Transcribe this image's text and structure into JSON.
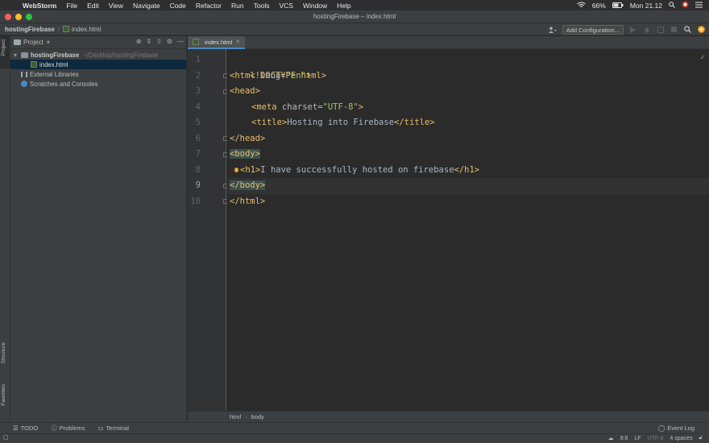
{
  "menubar": {
    "app_name": "WebStorm",
    "items": [
      "File",
      "Edit",
      "View",
      "Navigate",
      "Code",
      "Refactor",
      "Run",
      "Tools",
      "VCS",
      "Window",
      "Help"
    ],
    "battery": "66%",
    "clock": "Mon 21.12"
  },
  "window": {
    "title": "hostingFirebase – index.html",
    "traffic_colors": [
      "#fe5f57",
      "#febc2e",
      "#28c840"
    ]
  },
  "navbar": {
    "project": "hostingFirebase",
    "file": "index.html",
    "add_configuration": "Add Configuration..."
  },
  "left_stripe": {
    "project_tab": "Project",
    "structure_tab": "Structure",
    "favorites_tab": "Favorites"
  },
  "project_panel": {
    "title": "Project",
    "root_name": "hostingFirebase",
    "root_path": "~/Desktop/hostingFirebase",
    "file": "index.html",
    "external_libraries": "External Libraries",
    "scratches": "Scratches and Consoles"
  },
  "editor": {
    "tab_label": "index.html",
    "current_line": 9,
    "lines": [
      {
        "n": "1"
      },
      {
        "n": "2"
      },
      {
        "n": "3"
      },
      {
        "n": "4"
      },
      {
        "n": "5"
      },
      {
        "n": "6"
      },
      {
        "n": "7"
      },
      {
        "n": "8"
      },
      {
        "n": "9"
      },
      {
        "n": "10"
      }
    ],
    "code": {
      "l1_tag": "<!DOCTYPE html>",
      "l2_open": "<html ",
      "l2_attr": "lang=",
      "l2_val": "\"en\"",
      "l2_close": ">",
      "l3": "<head>",
      "l4_open": "<meta ",
      "l4_attr": "charset=",
      "l4_val": "\"UTF-8\"",
      "l4_close": ">",
      "l5_open": "<title>",
      "l5_text": "Hosting into Firebase",
      "l5_close": "</title>",
      "l6": "</head>",
      "l7": "<body>",
      "l8_open": "<h1>",
      "l8_text": "I have successfully hosted on firebase",
      "l8_close": "</h1>",
      "l9": "</body>",
      "l10": "</html>"
    },
    "breadcrumbs": [
      "html",
      "body"
    ]
  },
  "bottom_tools": {
    "todo": "TODO",
    "problems": "Problems",
    "terminal": "Terminal",
    "event_log": "Event Log"
  },
  "status": {
    "position": "9:8",
    "line_sep": "LF",
    "encoding": "UTF-8",
    "indent": "4 spaces"
  }
}
